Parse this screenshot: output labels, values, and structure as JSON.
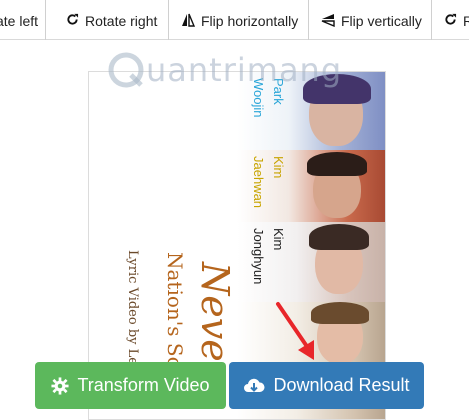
{
  "toolbar": {
    "rotate_left": "ate left",
    "rotate_right": "Rotate right",
    "flip_horizontally": "Flip horizontally",
    "flip_vertically": "Flip vertically",
    "reset": "R"
  },
  "watermark": {
    "text": "uantrimang"
  },
  "preview": {
    "title": "Never",
    "subtitle": "Nation's So",
    "credit": "Lyric Video by Lea",
    "members": [
      {
        "name_line1": "Park",
        "name_line2": "Woojin",
        "color": "#2aa6d8"
      },
      {
        "name_line1": "Kim",
        "name_line2": "Jaehwan",
        "color": "#c8a400"
      },
      {
        "name_line1": "Kim",
        "name_line2": "Jonghyun",
        "color": "#222222"
      },
      {
        "name_line1": "",
        "name_line2": "",
        "color": "#c8a400"
      }
    ]
  },
  "actions": {
    "transform_label": "Transform Video",
    "download_label": "Download Result"
  },
  "colors": {
    "transform": "#5cb85c",
    "download": "#337ab7",
    "arrow": "#e8262a"
  }
}
